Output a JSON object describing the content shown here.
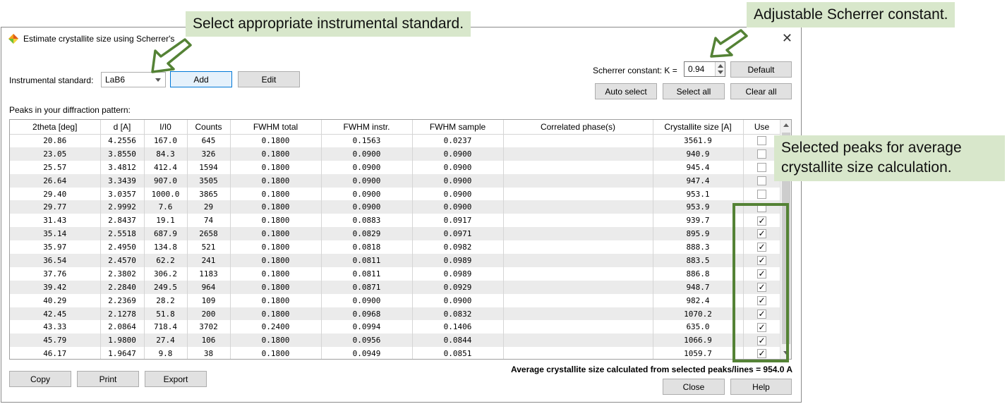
{
  "dialog": {
    "title": "Estimate crystallite size using Scherrer's",
    "close_glyph": "✕"
  },
  "toolbar": {
    "instrumental_label": "Instrumental standard:",
    "instrumental_value": "LaB6",
    "add_label": "Add",
    "edit_label": "Edit",
    "scherrer_label": "Scherrer constant: K =",
    "scherrer_value": "0.94",
    "default_label": "Default",
    "auto_select_label": "Auto select",
    "select_all_label": "Select all",
    "clear_all_label": "Clear all"
  },
  "peaks_label": "Peaks in your diffraction pattern:",
  "table": {
    "columns": [
      "2theta [deg]",
      "d [A]",
      "I/I0",
      "Counts",
      "FWHM total",
      "FWHM instr.",
      "FWHM sample",
      "Correlated phase(s)",
      "Crystallite size [A]",
      "Use"
    ],
    "rows": [
      [
        "20.86",
        "4.2556",
        "167.0",
        "645",
        "0.1800",
        "0.1563",
        "0.0237",
        "",
        "3561.9",
        false
      ],
      [
        "23.05",
        "3.8550",
        "84.3",
        "326",
        "0.1800",
        "0.0900",
        "0.0900",
        "",
        "940.9",
        false
      ],
      [
        "25.57",
        "3.4812",
        "412.4",
        "1594",
        "0.1800",
        "0.0900",
        "0.0900",
        "",
        "945.4",
        false
      ],
      [
        "26.64",
        "3.3439",
        "907.0",
        "3505",
        "0.1800",
        "0.0900",
        "0.0900",
        "",
        "947.4",
        false
      ],
      [
        "29.40",
        "3.0357",
        "1000.0",
        "3865",
        "0.1800",
        "0.0900",
        "0.0900",
        "",
        "953.1",
        false
      ],
      [
        "29.77",
        "2.9992",
        "7.6",
        "29",
        "0.1800",
        "0.0900",
        "0.0900",
        "",
        "953.9",
        false
      ],
      [
        "31.43",
        "2.8437",
        "19.1",
        "74",
        "0.1800",
        "0.0883",
        "0.0917",
        "",
        "939.7",
        true
      ],
      [
        "35.14",
        "2.5518",
        "687.9",
        "2658",
        "0.1800",
        "0.0829",
        "0.0971",
        "",
        "895.9",
        true
      ],
      [
        "35.97",
        "2.4950",
        "134.8",
        "521",
        "0.1800",
        "0.0818",
        "0.0982",
        "",
        "888.3",
        true
      ],
      [
        "36.54",
        "2.4570",
        "62.2",
        "241",
        "0.1800",
        "0.0811",
        "0.0989",
        "",
        "883.5",
        true
      ],
      [
        "37.76",
        "2.3802",
        "306.2",
        "1183",
        "0.1800",
        "0.0811",
        "0.0989",
        "",
        "886.8",
        true
      ],
      [
        "39.42",
        "2.2840",
        "249.5",
        "964",
        "0.1800",
        "0.0871",
        "0.0929",
        "",
        "948.7",
        true
      ],
      [
        "40.29",
        "2.2369",
        "28.2",
        "109",
        "0.1800",
        "0.0900",
        "0.0900",
        "",
        "982.4",
        true
      ],
      [
        "42.45",
        "2.1278",
        "51.8",
        "200",
        "0.1800",
        "0.0968",
        "0.0832",
        "",
        "1070.2",
        true
      ],
      [
        "43.33",
        "2.0864",
        "718.4",
        "3702",
        "0.2400",
        "0.0994",
        "0.1406",
        "",
        "635.0",
        true
      ],
      [
        "45.79",
        "1.9800",
        "27.4",
        "106",
        "0.1800",
        "0.0956",
        "0.0844",
        "",
        "1066.9",
        true
      ],
      [
        "46.17",
        "1.9647",
        "9.8",
        "38",
        "0.1800",
        "0.0949",
        "0.0851",
        "",
        "1059.7",
        true
      ]
    ],
    "check_glyph": "✓"
  },
  "footer": {
    "copy_label": "Copy",
    "print_label": "Print",
    "export_label": "Export",
    "average_text": "Average crystallite size calculated from selected peaks/lines = 954.0 A",
    "close_label": "Close",
    "help_label": "Help"
  },
  "annotations": {
    "instrumental_note": "Select appropriate instrumental standard.",
    "scherrer_note": "Adjustable Scherrer constant.",
    "selected_note": "Selected peaks for average crystallite size calculation."
  },
  "colors": {
    "callout_bg": "#d8e7cb",
    "highlight_border": "#548235",
    "row_alt": "#ebebeb",
    "focus_border": "#0078d7"
  }
}
